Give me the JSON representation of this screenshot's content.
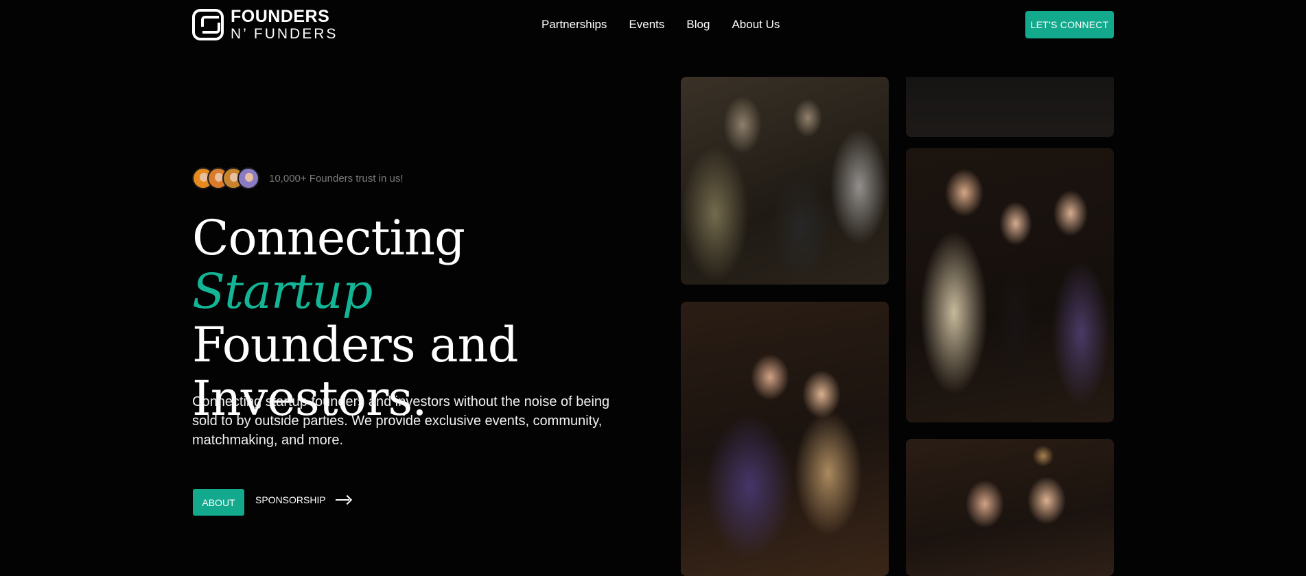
{
  "brand": {
    "line1": "FOUNDERS",
    "line2": "N’ FUNDERS",
    "accent_color": "#12a98c"
  },
  "nav": {
    "items": [
      "Partnerships",
      "Events",
      "Blog",
      "About Us"
    ]
  },
  "header": {
    "cta_label": "LET’S CONNECT"
  },
  "trust": {
    "avatars": [
      {
        "name": "founder-avatar-1",
        "color": "#e68a1f"
      },
      {
        "name": "founder-avatar-2",
        "color": "#d97b2a"
      },
      {
        "name": "founder-avatar-3",
        "color": "#c8832d"
      },
      {
        "name": "founder-avatar-4",
        "color": "#8a7bc2"
      }
    ],
    "text": "10,000+ Founders trust in us!"
  },
  "hero": {
    "headline_word1": "Connecting",
    "headline_accent": "Startup",
    "headline_rest_line2": "Founders and",
    "headline_rest_line3": "Investors.",
    "description": "Connecting startup founders and investors without the noise of being sold to by outside parties. We provide exclusive events, community, matchmaking, and more.",
    "about_button": "ABOUT",
    "sponsorship_link": "SPONSORSHIP"
  },
  "gallery": {
    "photos": [
      "event-photo-group-conversation",
      "event-photo-top-right",
      "event-photo-forecastr-pair",
      "event-photo-three-attendees",
      "event-photo-laughing-pair"
    ]
  }
}
